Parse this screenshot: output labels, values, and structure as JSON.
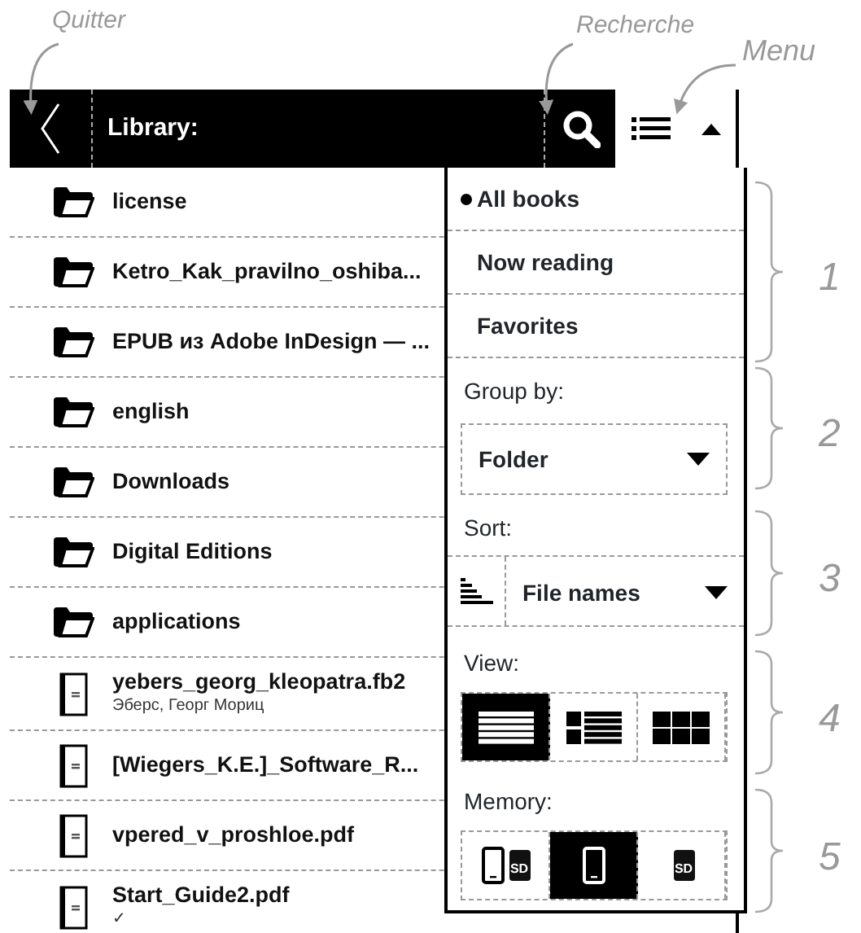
{
  "annotations": {
    "quit": "Quitter",
    "search": "Recherche",
    "menu": "Menu"
  },
  "callouts": [
    "1",
    "2",
    "3",
    "4",
    "5"
  ],
  "header": {
    "title": "Library:"
  },
  "files": [
    {
      "kind": "folder",
      "name": "license"
    },
    {
      "kind": "folder",
      "name": "Ketro_Kak_pravilno_oshiba..."
    },
    {
      "kind": "folder",
      "name": "EPUB из Adobe InDesign — ..."
    },
    {
      "kind": "folder",
      "name": "english"
    },
    {
      "kind": "folder",
      "name": "Downloads"
    },
    {
      "kind": "folder",
      "name": "Digital Editions"
    },
    {
      "kind": "folder",
      "name": "applications"
    },
    {
      "kind": "book",
      "name": "yebers_georg_kleopatra.fb2",
      "subtitle": "Эберс, Георг Мориц"
    },
    {
      "kind": "book",
      "name": "[Wiegers_K.E.]_Software_R..."
    },
    {
      "kind": "book",
      "name": "vpered_v_proshloe.pdf"
    },
    {
      "kind": "book",
      "name": "Start_Guide2.pdf",
      "subtitle": "✓"
    }
  ],
  "menu": {
    "shelves": [
      {
        "label": "All books",
        "selected": true
      },
      {
        "label": "Now reading",
        "selected": false
      },
      {
        "label": "Favorites",
        "selected": false
      }
    ],
    "group_by": {
      "label": "Group by:",
      "value": "Folder"
    },
    "sort": {
      "label": "Sort:",
      "value": "File names"
    },
    "view": {
      "label": "View:",
      "options": [
        {
          "kind": "list",
          "selected": true
        },
        {
          "kind": "detailed",
          "selected": false
        },
        {
          "kind": "grid",
          "selected": false
        }
      ]
    },
    "memory": {
      "label": "Memory:",
      "options": [
        {
          "kind": "both",
          "card_label": "SD",
          "selected": false
        },
        {
          "kind": "internal",
          "selected": true
        },
        {
          "kind": "sd",
          "card_label": "SD",
          "selected": false
        }
      ]
    }
  }
}
